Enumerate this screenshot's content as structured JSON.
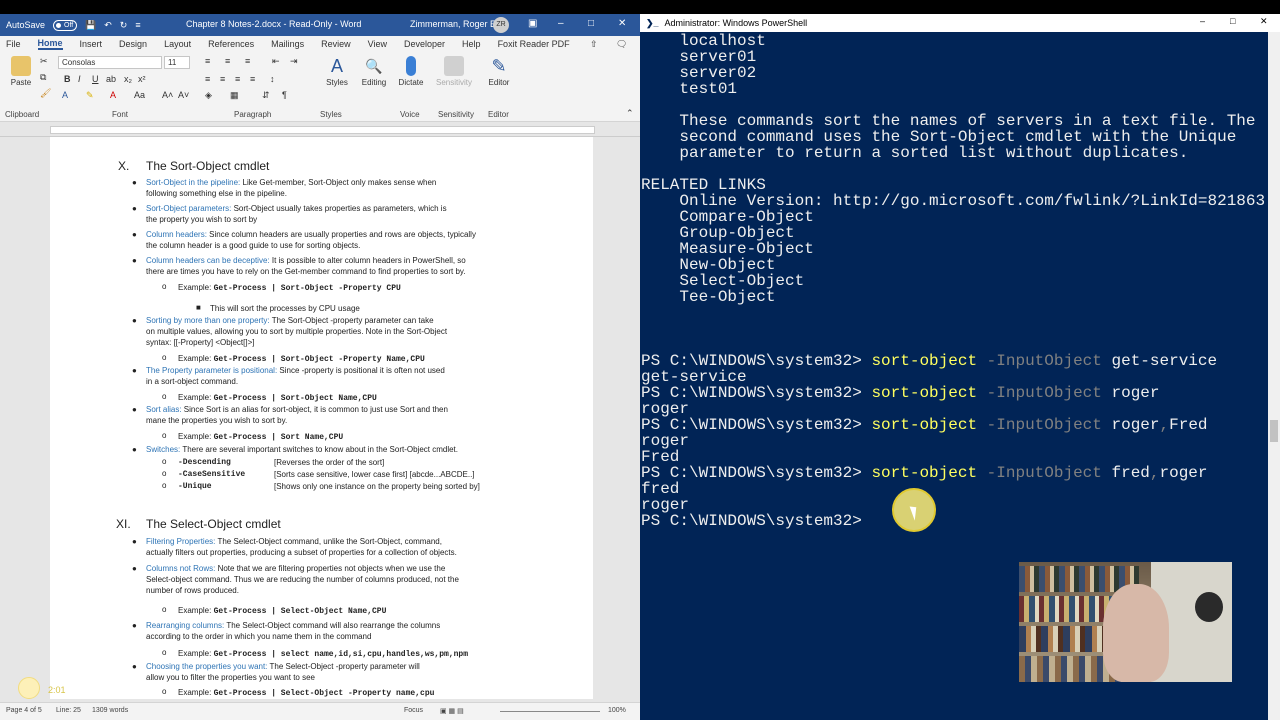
{
  "word": {
    "qat": {
      "autosave": "AutoSave",
      "toggle": "Off"
    },
    "title": "Chapter 8 Notes-2.docx  -  Read-Only  -  Word",
    "user": "Zimmerman, Roger E",
    "user_initials": "ZR",
    "tabs": [
      "File",
      "Home",
      "Insert",
      "Design",
      "Layout",
      "References",
      "Mailings",
      "Review",
      "View",
      "Developer",
      "Help",
      "Foxit Reader PDF"
    ],
    "ribbon": {
      "font_name": "Consolas",
      "font_size": "11",
      "groups": [
        "Clipboard",
        "Font",
        "Paragraph",
        "Styles",
        "Voice",
        "Sensitivity",
        "Editor"
      ],
      "paste": "Paste",
      "styles": "Styles",
      "editing": "Editing",
      "dictate": "Dictate",
      "sensitivity": "Sensitivity",
      "editor": "Editor"
    },
    "doc": {
      "sec10_num": "X.",
      "sec10_title": "The Sort-Object cmdlet",
      "sec10": [
        {
          "lead": "Sort-Object in the pipeline:",
          "text": " Like Get-member, Sort-Object only makes sense when",
          "text2": "following something else in the pipeline."
        },
        {
          "lead": "Sort-Object parameters:",
          "text": " Sort-Object usually takes properties as parameters, which is",
          "text2": "the property you wish to sort by"
        },
        {
          "lead": "Column headers:",
          "text": " Since column headers are usually properties and rows are objects, typically",
          "text2": "the column header is a good guide to use for sorting objects."
        },
        {
          "lead": "Column headers can be deceptive:",
          "text": " It is possible to alter column headers in PowerShell, so",
          "text2": "there are times you have to rely on the Get-member command to find properties to sort by."
        },
        {
          "ex": "Example: ",
          "code": "Get-Process  | Sort-Object -Property CPU"
        },
        {
          "sub": "This will sort the processes by CPU usage"
        },
        {
          "lead": "Sorting by more than one property:",
          "text": " The Sort-Object -property parameter can take",
          "text2": "on multiple values, allowing you to sort by multiple properties. Note in the Sort-Object",
          "text3": "syntax:  [[-Property] <Object[]>]"
        },
        {
          "ex": "Example: ",
          "code": "Get-Process | Sort-Object -Property Name,CPU"
        },
        {
          "lead": "The Property parameter is positional:",
          "text": " Since -property is positional it is often not used",
          "text2": "in a sort-object command."
        },
        {
          "ex": "Example: ",
          "code": "Get-Process | Sort-Object Name,CPU"
        },
        {
          "lead": "Sort alias:",
          "text": " Since Sort is an alias for sort-object, it is common to just use Sort and then",
          "text2": "mane the properties you wish to sort by."
        },
        {
          "ex": "Example: ",
          "code": "Get-Process | Sort   Name,CPU"
        },
        {
          "lead": "Switches:",
          "text": " There are several important switches to know about in the Sort-Object cmdlet."
        }
      ],
      "switches": [
        {
          "name": "-Descending",
          "desc": "[Reverses the order of the sort]"
        },
        {
          "name": "-CaseSensitive",
          "desc": "[Sorts case sensitive, lower case first] [abcde...ABCDE..]"
        },
        {
          "name": "-Unique",
          "desc": "[Shows only one instance on the property being sorted by]"
        }
      ],
      "sec11_num": "XI.",
      "sec11_title": "The Select-Object cmdlet",
      "sec11": [
        {
          "lead": "Filtering Properties:",
          "text": " The Select-Object command, unlike the Sort-Object, command,",
          "text2": "actually filters out properties, producing a subset of properties for a collection of objects."
        },
        {
          "lead": "Columns not Rows:",
          "text": " Note that we are filtering properties not objects when we use the",
          "text2": "Select-object command. Thus we are reducing the number of columns produced, not the",
          "text3": "number of rows produced."
        },
        {
          "ex": "Example: ",
          "code": "Get-Process | Select-Object Name,CPU"
        },
        {
          "lead": "Rearranging columns:",
          "text": " The Select-Object command will also rearrange the columns",
          "text2": "according to the order in which you name them in the command"
        },
        {
          "ex": "Example: ",
          "code": "Get-Process | select name,id,si,cpu,handles,ws,pm,npm"
        },
        {
          "lead": "Choosing the properties you want:",
          "text": " The Select-Object -property parameter will",
          "text2": "allow you to filter the properties you want to see"
        },
        {
          "ex": "Example: ",
          "code": "Get-Process | Select-Object -Property name,cpu"
        }
      ]
    },
    "status": {
      "page": "Page 4 of 5",
      "line": "Line: 25",
      "words": "1309 words",
      "focus": "Focus",
      "zoom": "100%"
    },
    "timer": "2:01"
  },
  "powershell": {
    "title": "Administrator: Windows PowerShell",
    "lines": [
      {
        "text": "    localhost"
      },
      {
        "text": "    server01"
      },
      {
        "text": "    server02"
      },
      {
        "text": "    test01"
      },
      {
        "text": ""
      },
      {
        "text": "    These commands sort the names of servers in a text file. The"
      },
      {
        "text": "    second command uses the Sort-Object cmdlet with the Unique"
      },
      {
        "text": "    parameter to return a sorted list without duplicates."
      },
      {
        "text": ""
      },
      {
        "text": "RELATED LINKS"
      },
      {
        "text": "    Online Version: http://go.microsoft.com/fwlink/?LinkId=821863"
      },
      {
        "text": "    Compare-Object"
      },
      {
        "text": "    Group-Object"
      },
      {
        "text": "    Measure-Object"
      },
      {
        "text": "    New-Object"
      },
      {
        "text": "    Select-Object"
      },
      {
        "text": "    Tee-Object"
      },
      {
        "text": ""
      },
      {
        "text": ""
      },
      {
        "text": ""
      },
      {
        "prompt": "PS C:\\WINDOWS\\system32> ",
        "cmd": "sort-object",
        "param": " -InputObject ",
        "arg": "get-service"
      },
      {
        "text": "get-service"
      },
      {
        "prompt": "PS C:\\WINDOWS\\system32> ",
        "cmd": "sort-object",
        "param": " -InputObject ",
        "arg": "roger"
      },
      {
        "text": "roger"
      },
      {
        "prompt": "PS C:\\WINDOWS\\system32> ",
        "cmd": "sort-object",
        "param": " -InputObject ",
        "arg": "roger",
        "sep": ",",
        "arg2": "Fred"
      },
      {
        "text": "roger"
      },
      {
        "text": "Fred"
      },
      {
        "prompt": "PS C:\\WINDOWS\\system32> ",
        "cmd": "sort-object",
        "param": " -InputObject ",
        "arg": "fred",
        "sep": ",",
        "arg2": "roger"
      },
      {
        "text": "fred"
      },
      {
        "text": "roger"
      },
      {
        "prompt": "PS C:\\WINDOWS\\system32> "
      }
    ]
  }
}
